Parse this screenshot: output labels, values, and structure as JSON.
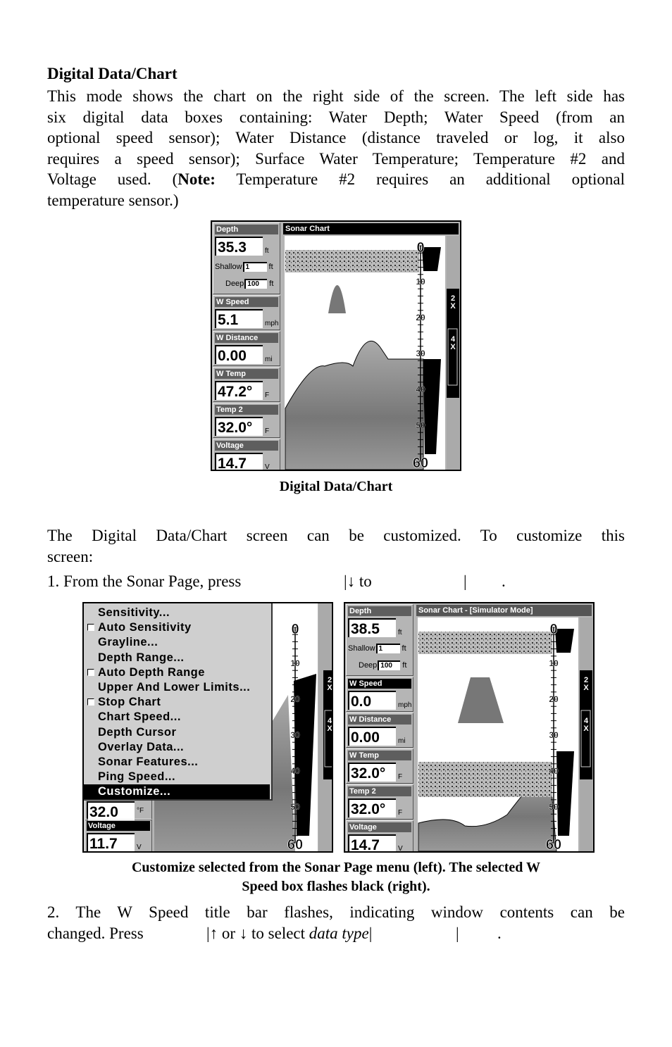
{
  "heading": "Digital Data/Chart",
  "para1": {
    "lines": [
      "This mode shows the chart on the right side of the screen. The left side has",
      "six digital data boxes containing: Water Depth; Water Speed (from an",
      "optional speed sensor); Water Distance (distance traveled or log, it also",
      "requires a speed sensor); Surface Water Temperature; Temperature #2 and"
    ],
    "line5_a": "Voltage used. (",
    "line5_note": "Note:",
    "line5_b": " Temperature #2 requires an additional optional",
    "line6": "temperature sensor.)"
  },
  "figure1": {
    "screen": {
      "chart_title": "Sonar Chart",
      "depth": {
        "title": "Depth",
        "value": "35.3",
        "unit": "ft",
        "shallow_label": "Shallow",
        "shallow": "1",
        "shallow_unit": "ft",
        "deep_label": "Deep",
        "deep": "100",
        "deep_unit": "ft"
      },
      "boxes": [
        {
          "title": "W Speed",
          "value": "5.1",
          "unit": "mph"
        },
        {
          "title": "W Distance",
          "value": "0.00",
          "unit": "mi"
        },
        {
          "title": "W Temp",
          "value": "47.2°",
          "unit": "F"
        },
        {
          "title": "Temp 2",
          "value": "32.0°",
          "unit": "F"
        },
        {
          "title": "Voltage",
          "value": "14.7",
          "unit": "V"
        }
      ],
      "scale": [
        "0",
        "10",
        "20",
        "30",
        "40",
        "50",
        "60"
      ],
      "zoom": [
        "2X",
        "4X"
      ]
    },
    "caption": "Digital Data/Chart"
  },
  "para2": {
    "line1": "The Digital Data/Chart screen can be customized. To customize this",
    "line2": "screen:"
  },
  "step1": {
    "a": "1. From the Sonar Page, press",
    "b": "|↓ to",
    "c": "|",
    "d": "."
  },
  "figure2": {
    "left": {
      "menu": [
        {
          "label": "Sensitivity...",
          "checkbox": false
        },
        {
          "label": "Auto Sensitivity",
          "checkbox": true,
          "checked": false
        },
        {
          "label": "Grayline...",
          "checkbox": false
        },
        {
          "label": "Depth Range...",
          "checkbox": false
        },
        {
          "label": "Auto Depth Range",
          "checkbox": true,
          "checked": false
        },
        {
          "label": "Upper And Lower Limits...",
          "checkbox": false
        },
        {
          "label": "Stop Chart",
          "checkbox": true,
          "checked": false
        },
        {
          "label": "Chart Speed...",
          "checkbox": false
        },
        {
          "label": "Depth Cursor",
          "checkbox": false
        },
        {
          "label": "Overlay Data...",
          "checkbox": false
        },
        {
          "label": "Sonar Features...",
          "checkbox": false
        },
        {
          "label": "Ping Speed...",
          "checkbox": false
        },
        {
          "label": "Customize...",
          "checkbox": false,
          "selected": true
        }
      ],
      "temp_value": "32.0",
      "temp_unit": "°F",
      "voltage": {
        "title": "Voltage",
        "value": "11.7",
        "unit": "V"
      },
      "scale": [
        "0",
        "10",
        "20",
        "30",
        "40",
        "50",
        "60"
      ],
      "zoom": [
        "2X",
        "4X"
      ]
    },
    "right": {
      "chart_title": "Sonar Chart - [Simulator Mode]",
      "depth": {
        "title": "Depth",
        "value": "38.5",
        "unit": "ft",
        "shallow_label": "Shallow",
        "shallow": "1",
        "shallow_unit": "ft",
        "deep_label": "Deep",
        "deep": "100",
        "deep_unit": "ft"
      },
      "boxes": [
        {
          "title": "W Speed",
          "value": "0.0",
          "unit": "mph",
          "selected": true
        },
        {
          "title": "W Distance",
          "value": "0.00",
          "unit": "mi"
        },
        {
          "title": "W Temp",
          "value": "32.0°",
          "unit": "F"
        },
        {
          "title": "Temp 2",
          "value": "32.0°",
          "unit": "F"
        },
        {
          "title": "Voltage",
          "value": "14.7",
          "unit": "V"
        }
      ],
      "scale": [
        "0",
        "10",
        "20",
        "30",
        "40",
        "50",
        "60"
      ],
      "zoom": [
        "2X",
        "4X"
      ]
    },
    "caption_line1": "Customize selected from the Sonar Page menu (left). The selected W",
    "caption_line2": "Speed box flashes black (right)."
  },
  "step2": {
    "line1": "2. The W Speed title bar flashes, indicating window contents can be",
    "a": "changed. Press",
    "b": "|↑ or ↓ to select ",
    "c": "data type",
    "d": "|",
    "e": "|",
    "f": "."
  }
}
